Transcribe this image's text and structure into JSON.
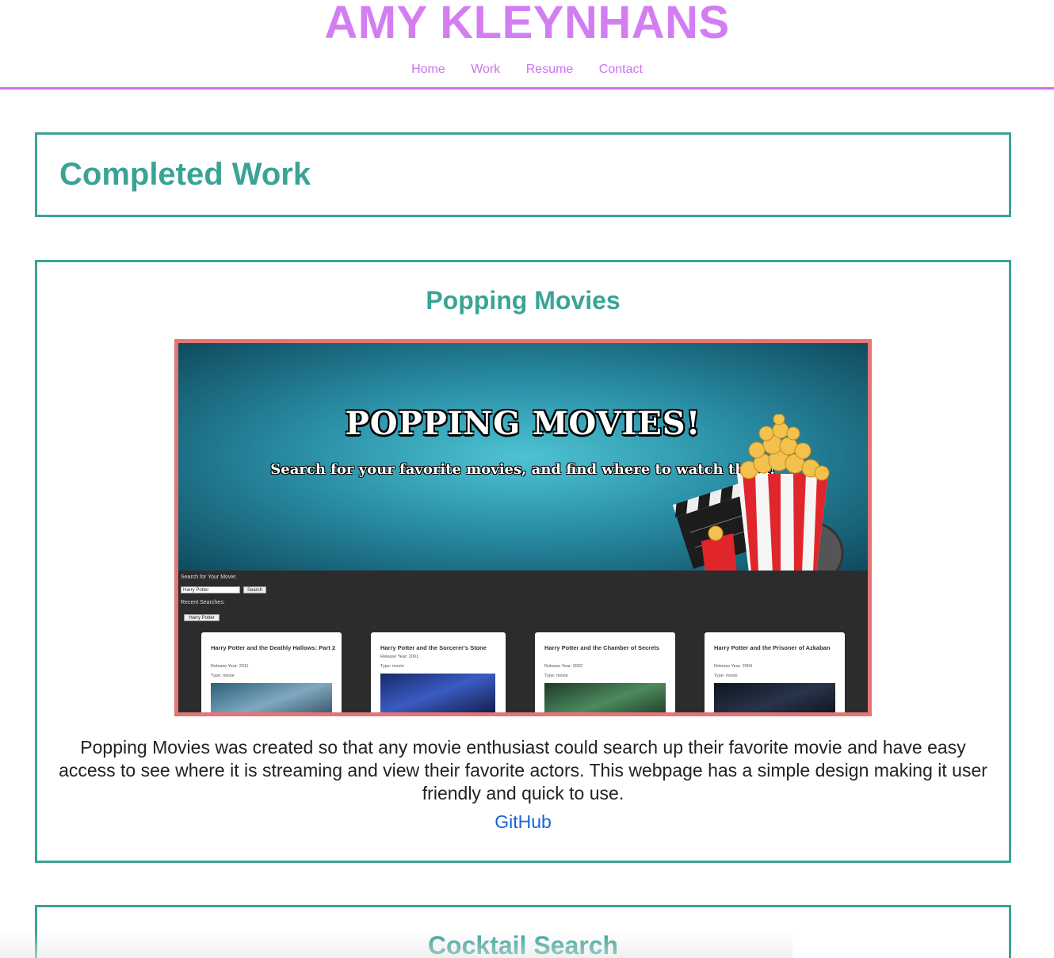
{
  "header": {
    "title": "AMY KLEYNHANS",
    "nav": [
      "Home",
      "Work",
      "Resume",
      "Contact"
    ]
  },
  "section": {
    "title": "Completed Work"
  },
  "projects": [
    {
      "title": "Popping Movies",
      "screenshot": {
        "hero_title": "POPPING MOVIES!",
        "hero_subtitle": "Search for your favorite movies, and find where to watch them!",
        "search_label": "Search for Your Movie:",
        "search_value": "Harry Potter",
        "search_button": "Search",
        "recent_label": "Recent Searches:",
        "recent_items": [
          "Harry Potter"
        ],
        "movies": [
          {
            "title": "Harry Potter and the Deathly Hallows: Part 2",
            "year": "Release Year: 2011",
            "type": "Type: movie"
          },
          {
            "title": "Harry Potter and the Sorcerer's Stone",
            "year": "Release Year: 2001",
            "type": "Type: movie"
          },
          {
            "title": "Harry Potter and the Chamber of Secrets",
            "year": "Release Year: 2002",
            "type": "Type: movie"
          },
          {
            "title": "Harry Potter and the Prisoner of Azkaban",
            "year": "Release Year: 2004",
            "type": "Type: movie"
          }
        ]
      },
      "description": "Popping Movies was created so that any movie enthusiast could search up their favorite movie and have easy access to see where it is streaming and view their favorite actors. This webpage has a simple design making it user friendly and quick to use.",
      "link_label": "GitHub"
    },
    {
      "title": "Cocktail Search"
    }
  ],
  "colors": {
    "accent_purple": "#d27ef2",
    "accent_teal": "#3aa396",
    "frame_red": "#e47575",
    "link_blue": "#1a62e0"
  }
}
